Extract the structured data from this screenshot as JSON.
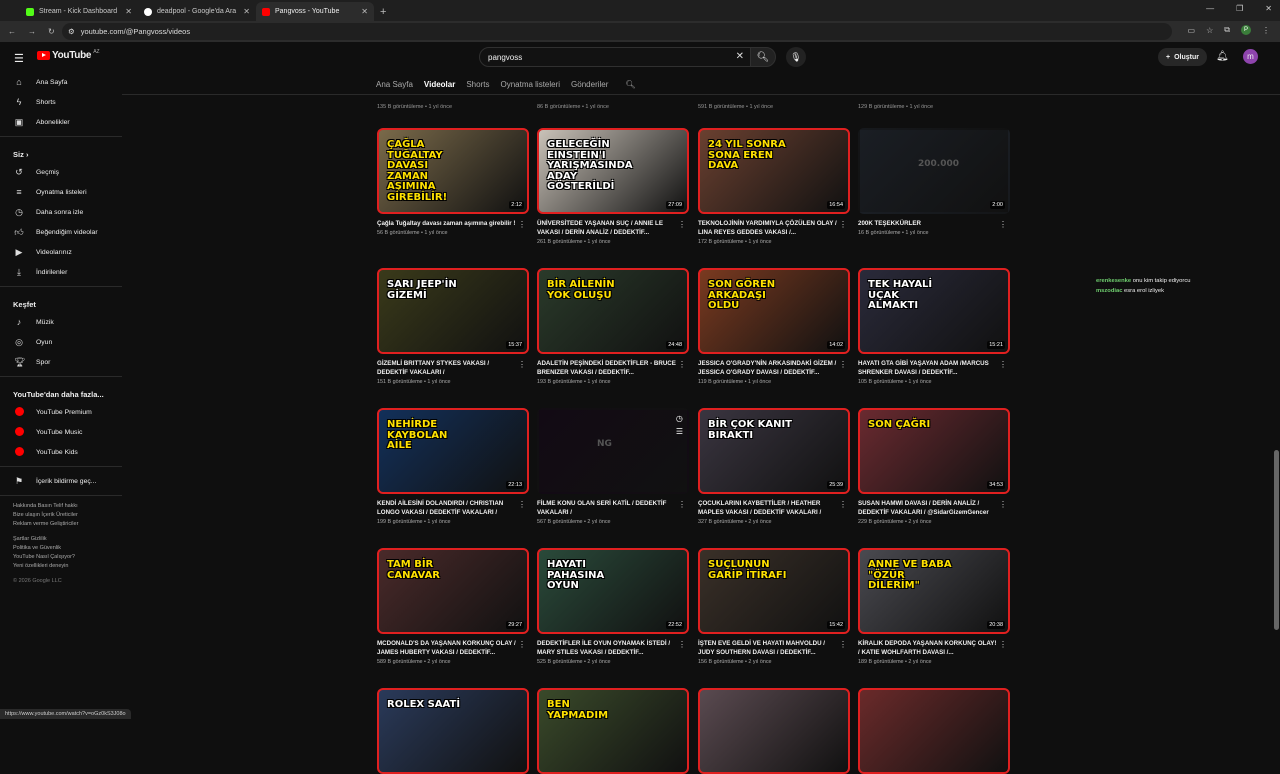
{
  "browser": {
    "tabs": [
      {
        "title": "Stream - Kick Dashboard",
        "color": "#53fc18"
      },
      {
        "title": "deadpool - Google'da Ara",
        "color": "#ffffff"
      },
      {
        "title": "Pangvoss - YouTube",
        "color": "#ff0000"
      }
    ],
    "url": "youtube.com/@Pangvoss/videos",
    "profile": "P"
  },
  "header": {
    "logo": "YouTube",
    "country": "AZ",
    "search_value": "pangvoss",
    "create_label": "Oluştur",
    "avatar": "m"
  },
  "sidebar": {
    "main": [
      "Ana Sayfa",
      "Shorts",
      "Abonelikler"
    ],
    "you_label": "Siz",
    "you_items": [
      "Geçmiş",
      "Oynatma listeleri",
      "Daha sonra izle",
      "Beğendiğim videolar",
      "Videolarınız",
      "İndirilenler"
    ],
    "explore_label": "Keşfet",
    "explore_items": [
      "Müzik",
      "Oyun",
      "Spor"
    ],
    "more_label": "YouTube'dan daha fazla...",
    "more_items": [
      "YouTube Premium",
      "YouTube Music",
      "YouTube Kids"
    ],
    "feedback": "İçerik bildirme geç...",
    "footer1": "Hakkında  Basın  Telif hakkı",
    "footer2": "Bize ulaşın  İçerik Üreticiler",
    "footer3": "Reklam verme  Geliştiriciler",
    "footer4": "Şartlar  Gizlilik",
    "footer5": "Politika ve Güvenlik",
    "footer6": "YouTube Nasıl Çalışıyor?",
    "footer7": "Yeni özellikleri deneyin",
    "copyright": "© 2026 Google LLC"
  },
  "channel_tabs": [
    "Ana Sayfa",
    "Videolar",
    "Shorts",
    "Oynatma listeleri",
    "Gönderiler"
  ],
  "top_row_meta": [
    "135 B görüntüleme • 1 yıl önce",
    "86 B görüntüleme • 1 yıl önce",
    "591 B görüntüleme • 1 yıl önce",
    "129 B görüntüleme • 1 yıl önce"
  ],
  "videos": [
    {
      "title": "Çağla Tuğaltay davası zaman aşımına girebilir !",
      "meta": "56 B görüntüleme • 1 yıl önce",
      "dur": "2:12",
      "thumb": "ÇAĞLA TUĞALTAY DAVASI ZAMAN AŞIMINA GİREBİLİR!",
      "bg": "#7a6a4a"
    },
    {
      "title": "ÜNİVERSİTEDE YAŞANAN SUÇ / ANNIE LE VAKASI / DERİN ANALİZ / DEDEKTİF...",
      "meta": "261 B görüntüleme • 1 yıl önce",
      "dur": "27:09",
      "thumb": "GELECEĞİN EINSTEIN'I YARIŞMASINDA ADAY GÖSTERİLDİ",
      "bg": "#c9c2b8"
    },
    {
      "title": "TEKNOLOJİNİN YARDIMIYLA ÇÖZÜLEN OLAY / LINA REYES GEDDES VAKASI /...",
      "meta": "172 B görüntüleme • 1 yıl önce",
      "dur": "16:54",
      "thumb": "24 YIL SONRA SONA EREN DAVA",
      "bg": "#6a4030"
    },
    {
      "title": "200K TEŞEKKÜRLER",
      "meta": "16 B görüntüleme • 1 yıl önce",
      "dur": "2:00",
      "thumb": "200.000",
      "bg": "#1a1e24",
      "plain": true
    },
    {
      "title": "GİZEMLİ BRITTANY STYKES VAKASI / DEDEKTİF VAKALARI /",
      "meta": "151 B görüntüleme • 1 yıl önce",
      "dur": "15:37",
      "thumb": "SARI JEEP'İN GİZEMİ",
      "bg": "#3a3a1a"
    },
    {
      "title": "ADALETİN PEŞİNDEKİ DEDEKTİFLER - BRUCE BRENIZER VAKASI / DEDEKTİF...",
      "meta": "193 B görüntüleme • 1 yıl önce",
      "dur": "24:48",
      "thumb": "BİR AİLENİN YOK OLUŞU",
      "bg": "#2a3a2a"
    },
    {
      "title": "JESSICA O'GRADY'NİN ARKASINDAKİ GİZEM / JESSICA O'GRADY DAVASI / DEDEKTİF...",
      "meta": "119 B görüntüleme • 1 yıl önce",
      "dur": "14:02",
      "thumb": "SON GÖREN ARKADAŞI OLDU",
      "bg": "#7a3a20"
    },
    {
      "title": "HAYATI GTA GİBİ YAŞAYAN ADAM /MARCUS SHRENKER DAVASI / DEDEKTİF...",
      "meta": "105 B görüntüleme • 1 yıl önce",
      "dur": "15:21",
      "thumb": "TEK HAYALİ UÇAK ALMAKTI",
      "bg": "#2a2a3a"
    },
    {
      "title": "KENDİ AİLESİNİ DOLANDIRDI / CHRISTIAN LONGO VAKASI / DEDEKTİF VAKALARI /",
      "meta": "199 B görüntüleme • 1 yıl önce",
      "dur": "22:13",
      "thumb": "NEHİRDE KAYBOLAN AİLE",
      "bg": "#12305a"
    },
    {
      "title": "FİLME KONU OLAN SERİ KATİL / DEDEKTİF VAKALARI /",
      "meta": "567 B görüntüleme • 2 yıl önce",
      "dur": "",
      "thumb": "NG",
      "bg": "#120a14",
      "plain": true
    },
    {
      "title": "ÇOCUKLARINI KAYBETTİLER / HEATHER MAPLES VAKASI / DEDEKTİF VAKALARI /",
      "meta": "327 B görüntüleme • 2 yıl önce",
      "dur": "25:39",
      "thumb": "BİR ÇOK KANIT BIRAKTI",
      "bg": "#3a3540"
    },
    {
      "title": "SUSAN HAMWI DAVASI / DERİN ANALİZ / DEDEKTİF VAKALARI / @SidarGizemGencer",
      "meta": "229 B görüntüleme • 2 yıl önce",
      "dur": "34:53",
      "thumb": "SON ÇAĞRI",
      "bg": "#6a2a30"
    },
    {
      "title": "MCDONALD'S DA YAŞANAN KORKUNÇ OLAY / JAMES HUBERTY VAKASI / DEDEKTİF...",
      "meta": "589 B görüntüleme • 2 yıl önce",
      "dur": "29:27",
      "thumb": "TAM BİR CANAVAR",
      "bg": "#4a2a2a"
    },
    {
      "title": "DEDEKTİFLER İLE OYUN OYNAMAK İSTEDİ / MARY STILES VAKASI / DEDEKTİF...",
      "meta": "525 B görüntüleme • 2 yıl önce",
      "dur": "22:52",
      "thumb": "HAYATI PAHASINA OYUN",
      "bg": "#2a4a3a"
    },
    {
      "title": "İŞTEN EVE GELDİ VE HAYATI MAHVOLDU / JUDY SOUTHERN DAVASI / DEDEKTİF...",
      "meta": "156 B görüntüleme • 2 yıl önce",
      "dur": "15:42",
      "thumb": "SUÇLUNUN GARİP İTİRAFI",
      "bg": "#3a3028"
    },
    {
      "title": "KİRALIK DEPODA YAŞANAN KORKUNÇ OLAY! / KATIE WOHLFARTH DAVASI /...",
      "meta": "189 B görüntüleme • 2 yıl önce",
      "dur": "20:38",
      "thumb": "ANNE VE BABA \"ÖZÜR DİLERİM\"",
      "bg": "#4a4a50"
    },
    {
      "title": "",
      "meta": "",
      "dur": "",
      "thumb": "ROLEX SAATİ",
      "bg": "#2a3a5a"
    },
    {
      "title": "",
      "meta": "",
      "dur": "",
      "thumb": "BEN YAPMADIM",
      "bg": "#3a4a2a"
    },
    {
      "title": "",
      "meta": "",
      "dur": "",
      "thumb": "",
      "bg": "#5a4a50"
    },
    {
      "title": "",
      "meta": "",
      "dur": "",
      "thumb": "",
      "bg": "#6a2a2a"
    }
  ],
  "chat": [
    {
      "user": "erenkesenke",
      "msg": "onu kim takip ediyorcu"
    },
    {
      "user": "mszodiac",
      "msg": "esra erol izliyek"
    }
  ],
  "status_url": "https://www.youtube.com/watch?v=oGz0kS3J08o"
}
